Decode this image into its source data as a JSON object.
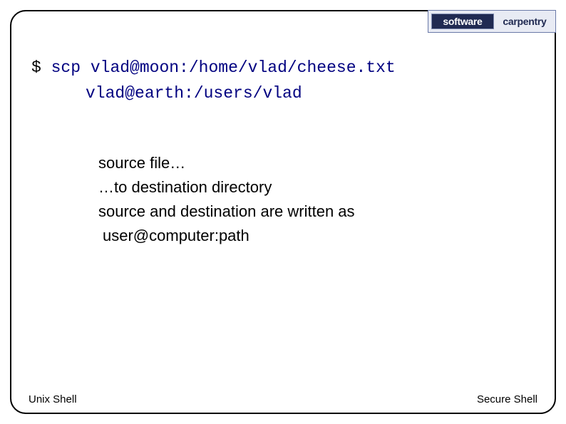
{
  "logo": {
    "word1": "software",
    "word2": "carpentry"
  },
  "command": {
    "prompt": "$",
    "line1": "scp vlad@moon:/home/vlad/cheese.txt",
    "line2": "vlad@earth:/users/vlad"
  },
  "body": {
    "l1": "source file…",
    "l2": "…to destination directory",
    "l3": "source and destination are written as",
    "l4": "user@computer:path"
  },
  "footer": {
    "left": "Unix Shell",
    "right": "Secure Shell"
  }
}
